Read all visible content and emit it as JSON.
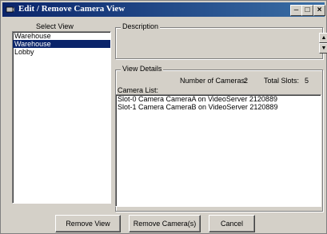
{
  "window": {
    "title": "Edit / Remove Camera View"
  },
  "select_view": {
    "label": "Select View",
    "items": [
      {
        "label": "Warehouse",
        "selected": false
      },
      {
        "label": "Warehouse",
        "selected": true
      },
      {
        "label": "Lobby",
        "selected": false
      }
    ]
  },
  "description": {
    "label": "Description",
    "value": ""
  },
  "view_details": {
    "label": "View Details",
    "num_cameras_label": "Number of Cameras:",
    "num_cameras_value": "2",
    "total_slots_label": "Total Slots:",
    "total_slots_value": "5",
    "camera_list_label": "Camera List:",
    "cameras": [
      "Slot-0 Camera CameraA on VideoServer 2120889",
      "Slot-1 Camera CameraB on VideoServer 2120889"
    ]
  },
  "buttons": {
    "remove_view": "Remove View",
    "remove_cameras": "Remove Camera(s)",
    "cancel": "Cancel"
  },
  "colors": {
    "titlebar": "#0a246a",
    "selection": "#0a246a",
    "face": "#d4d0c8"
  },
  "icons": [
    "camera-app-icon",
    "minimize-icon",
    "maximize-icon",
    "close-icon",
    "spin-up-icon",
    "spin-down-icon"
  ]
}
